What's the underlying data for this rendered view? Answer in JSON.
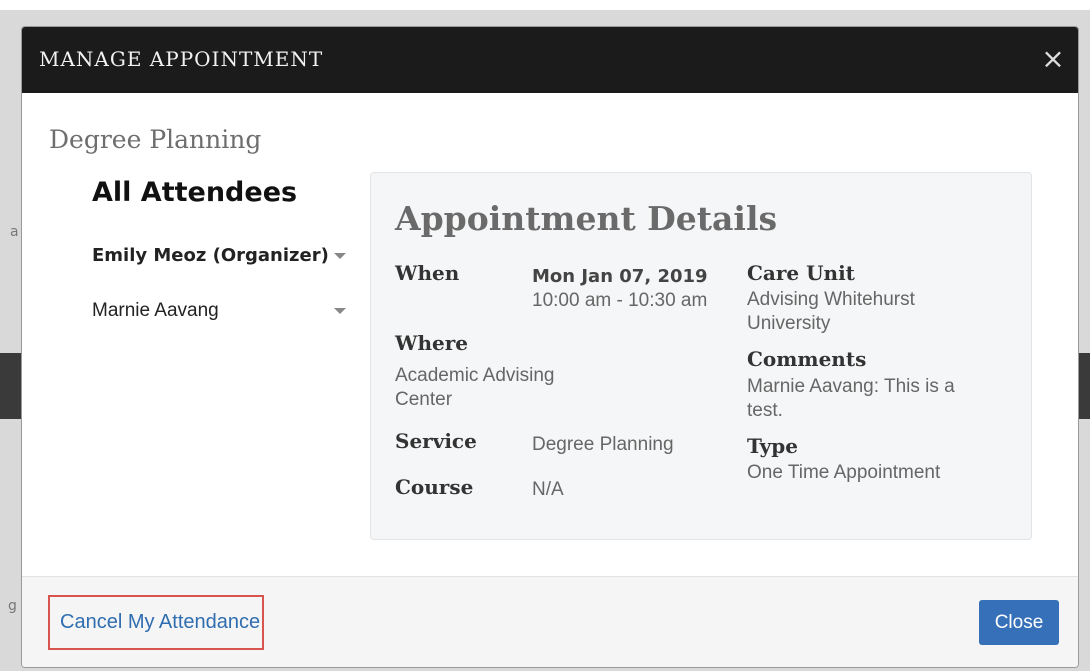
{
  "background": {
    "edge_left_top": "a",
    "edge_left_bottom": "g"
  },
  "modal": {
    "title": "MANAGE APPOINTMENT",
    "close_icon": "×",
    "subtitle": "Degree Planning"
  },
  "attendees": {
    "heading": "All Attendees",
    "items": [
      {
        "name": "Emily Meoz (Organizer)",
        "organizer": true
      },
      {
        "name": "Marnie Aavang",
        "organizer": false
      }
    ]
  },
  "details": {
    "title": "Appointment Details",
    "when_label": "When",
    "when_date": "Mon Jan 07, 2019",
    "when_time": "10:00 am - 10:30 am",
    "where_label": "Where",
    "where_value_line1": "Academic Advising",
    "where_value_line2": "Center",
    "service_label": "Service",
    "service_value": "Degree Planning",
    "course_label": "Course",
    "course_value": "N/A",
    "care_unit_label": "Care Unit",
    "care_unit_line1": "Advising Whitehurst",
    "care_unit_line2": "University",
    "comments_label": "Comments",
    "comments_line1": "Marnie Aavang: This is a",
    "comments_line2": "test.",
    "type_label": "Type",
    "type_value": "One Time Appointment"
  },
  "footer": {
    "cancel_label": "Cancel My Attendance",
    "close_label": "Close"
  },
  "colors": {
    "header_bg": "#1b1b1b",
    "link_blue": "#2f6db0",
    "button_blue": "#3570b8",
    "highlight_red": "#d9534f"
  },
  "icons": {
    "close": "close-icon",
    "caret": "chevron-down-icon"
  }
}
